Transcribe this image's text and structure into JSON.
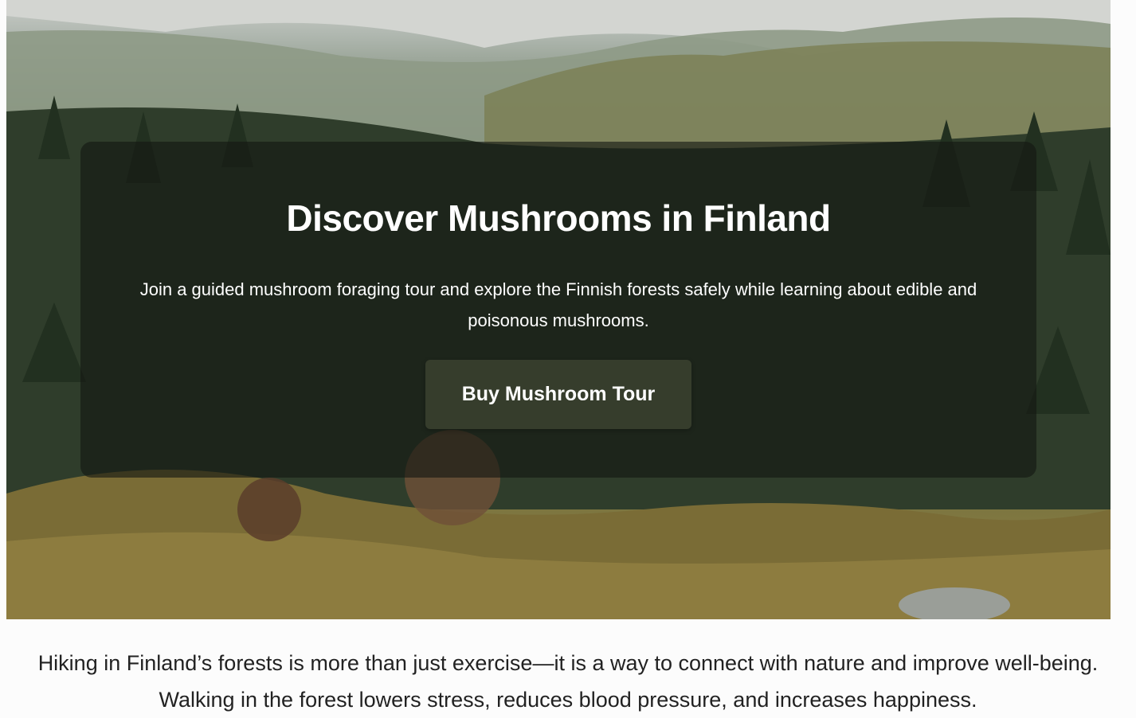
{
  "hero": {
    "background_image": "forest-hillside-image",
    "title": "Discover Mushrooms in Finland",
    "subtitle": "Join a guided mushroom foraging tour and explore the Finnish forests safely while learning about edible and poisonous mushrooms.",
    "cta_label": "Buy Mushroom Tour"
  },
  "intro": {
    "text": "Hiking in Finland’s forests is more than just exercise—it is a way to connect with nature and improve well-being. Walking in the forest lowers stress, reduces blood pressure, and increases happiness."
  },
  "colors": {
    "panel_overlay": "#141612",
    "button_bg": "#363d2c",
    "text_light": "#ffffff",
    "text_dark": "#222222",
    "page_bg": "#fcfcfc"
  }
}
